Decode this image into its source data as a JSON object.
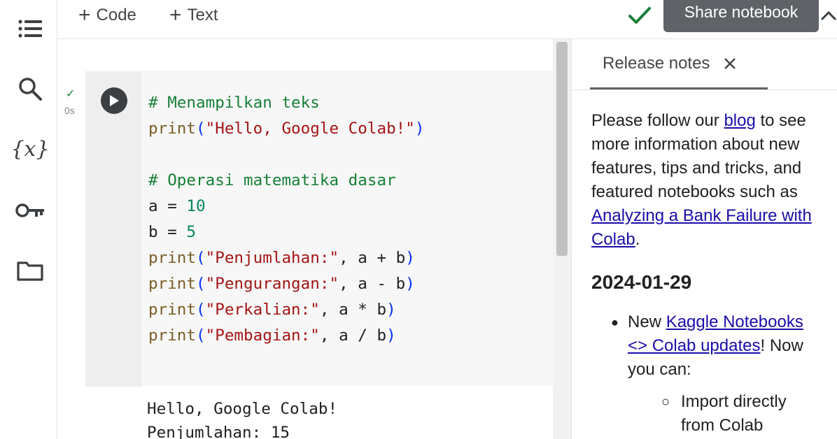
{
  "toolbar": {
    "add_code_label": "Code",
    "add_text_label": "Text",
    "share_tooltip": "Share notebook"
  },
  "cell": {
    "exec_time": "0s",
    "code_lines": [
      "# Menampilkan teks",
      "print(\"Hello, Google Colab!\")",
      "",
      "# Operasi matematika dasar",
      "a = 10",
      "b = 5",
      "print(\"Penjumlahan:\", a + b)",
      "print(\"Pengurangan:\", a - b)",
      "print(\"Perkalian:\", a * b)",
      "print(\"Pembagian:\", a / b)"
    ],
    "output_lines": [
      "Hello, Google Colab!",
      "Penjumlahan: 15"
    ]
  },
  "panel": {
    "tab_label": "Release notes",
    "intro": {
      "l1_pre": "Please follow our ",
      "l1_link": "blog",
      "l1_post": " to see",
      "l2": "more information about new",
      "l3": "features, tips and tricks, and",
      "l4": "featured notebooks such as",
      "l5_link": "Analyzing a Bank Failure with",
      "l6_link": "Colab",
      "l6_post": "."
    },
    "date": "2024-01-29",
    "bullet": {
      "l1_pre": "New ",
      "l1_link": "Kaggle Notebooks",
      "l2_link": "<> Colab updates",
      "l2_post": "! Now",
      "l3": "you can:"
    },
    "sub_bullet": {
      "l1": "Import directly",
      "l2": "from Colab"
    }
  },
  "colors": {
    "comment": "#188038",
    "builtin": "#795e26",
    "string": "#a31515",
    "number": "#098658",
    "paren": "#0431fa",
    "link": "#1a0dab",
    "tooltip_bg": "#5f6368",
    "saved_check": "#188038"
  },
  "icons": {
    "rail": [
      "table-of-contents-icon",
      "search-icon",
      "variables-icon",
      "secrets-key-icon",
      "files-folder-icon"
    ]
  }
}
